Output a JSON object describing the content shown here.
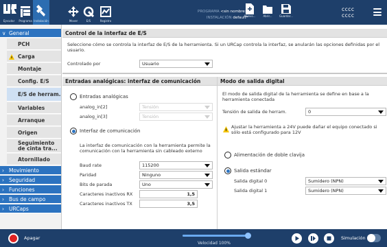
{
  "topbar": {
    "tabs": [
      {
        "label": "Ejecutar",
        "icon": "run-icon"
      },
      {
        "label": "Programa",
        "icon": "program-icon"
      },
      {
        "label": "Instalación",
        "icon": "installation-icon"
      },
      {
        "label": "Mover",
        "icon": "move-icon"
      },
      {
        "label": "E/S",
        "icon": "io-icon"
      },
      {
        "label": "Registro",
        "icon": "log-icon"
      }
    ],
    "program_label": "PROGRAMA",
    "program_value": "<sin nombre>",
    "installation_label": "INSTALACIÓN",
    "installation_value": "default*",
    "file_buttons": [
      {
        "label": "Nuevo...",
        "icon": "new-file-icon"
      },
      {
        "label": "Abrir...",
        "icon": "open-folder-icon"
      },
      {
        "label": "Guardar...",
        "icon": "save-icon"
      }
    ],
    "status_line1": "cccc",
    "status_line2": "cccc",
    "accent": "#2c6db1",
    "background": "#1e3f6a"
  },
  "sidebar": {
    "sections": [
      {
        "label": "General",
        "expanded": true
      },
      {
        "label": "Movimiento"
      },
      {
        "label": "Seguridad"
      },
      {
        "label": "Funciones"
      },
      {
        "label": "Bus de campo"
      },
      {
        "label": "URCaps"
      }
    ],
    "items": [
      {
        "label": "PCH"
      },
      {
        "label": "Carga",
        "warning": true
      },
      {
        "label": "Montaje"
      },
      {
        "label": "Config. E/S"
      },
      {
        "label": "E/S de herram.",
        "selected": true
      },
      {
        "label": "Variables"
      },
      {
        "label": "Arranque"
      },
      {
        "label": "Origen"
      },
      {
        "label": "Seguimiento de cinta tra..."
      },
      {
        "label": "Atornillado"
      }
    ]
  },
  "control": {
    "header": "Control de la interfaz de E/S",
    "description": "Seleccione cómo se controla la interfaz de E/S de la herramienta. Si un URCap controla la interfaz, se anularán las opciones definidas por el usuario.",
    "controlled_by_label": "Controlado por",
    "controlled_by_value": "Usuario"
  },
  "analog": {
    "header": "Entradas analógicas: interfaz de comunicación",
    "analog_inputs_label": "Entradas analógicas",
    "analog_in2_label": "analog_in[2]",
    "analog_in2_value": "Tensión",
    "analog_in3_label": "analog_in[3]",
    "analog_in3_value": "Tensión",
    "comm_interface_label": "Interfaz de comunicación",
    "comm_description": "La interfaz de comunicación con la herramienta permite la comunicación con la herramienta sin cableado externo",
    "selected": "comm",
    "fields": [
      {
        "label": "Baud rate",
        "value": "115200",
        "kind": "select"
      },
      {
        "label": "Paridad",
        "value": "Ninguno",
        "kind": "select"
      },
      {
        "label": "Bits de parada",
        "value": "Uno",
        "kind": "select"
      },
      {
        "label": "Caracteres inactivos RX",
        "value": "1,5",
        "kind": "number"
      },
      {
        "label": "Caracteres inactivos TX",
        "value": "3,5",
        "kind": "number"
      }
    ]
  },
  "digital": {
    "header": "Modo de salida digital",
    "description": "El modo de salida digital de la herramienta se define en base a la herramienta conectada",
    "voltage_label": "Tensión de salida de herram.",
    "voltage_value": "0",
    "warning_text": "Ajustar la herramienta a 24V puede dañar el equipo conectado si sólo está configurado para 12V",
    "dual_pin_label": "Alimentación de doble clavija",
    "standard_output_label": "Salida estándar",
    "selected": "standard",
    "outputs": [
      {
        "label": "Salida digital 0",
        "value": "Sumidero (NPN)"
      },
      {
        "label": "Salida digital 1",
        "value": "Sumidero (NPN)"
      }
    ]
  },
  "footer": {
    "power_label": "Apagar",
    "speed_label": "Velocidad 100%",
    "speed_fraction": 1.0,
    "simulation_label": "Simulación",
    "simulation_on": false
  }
}
